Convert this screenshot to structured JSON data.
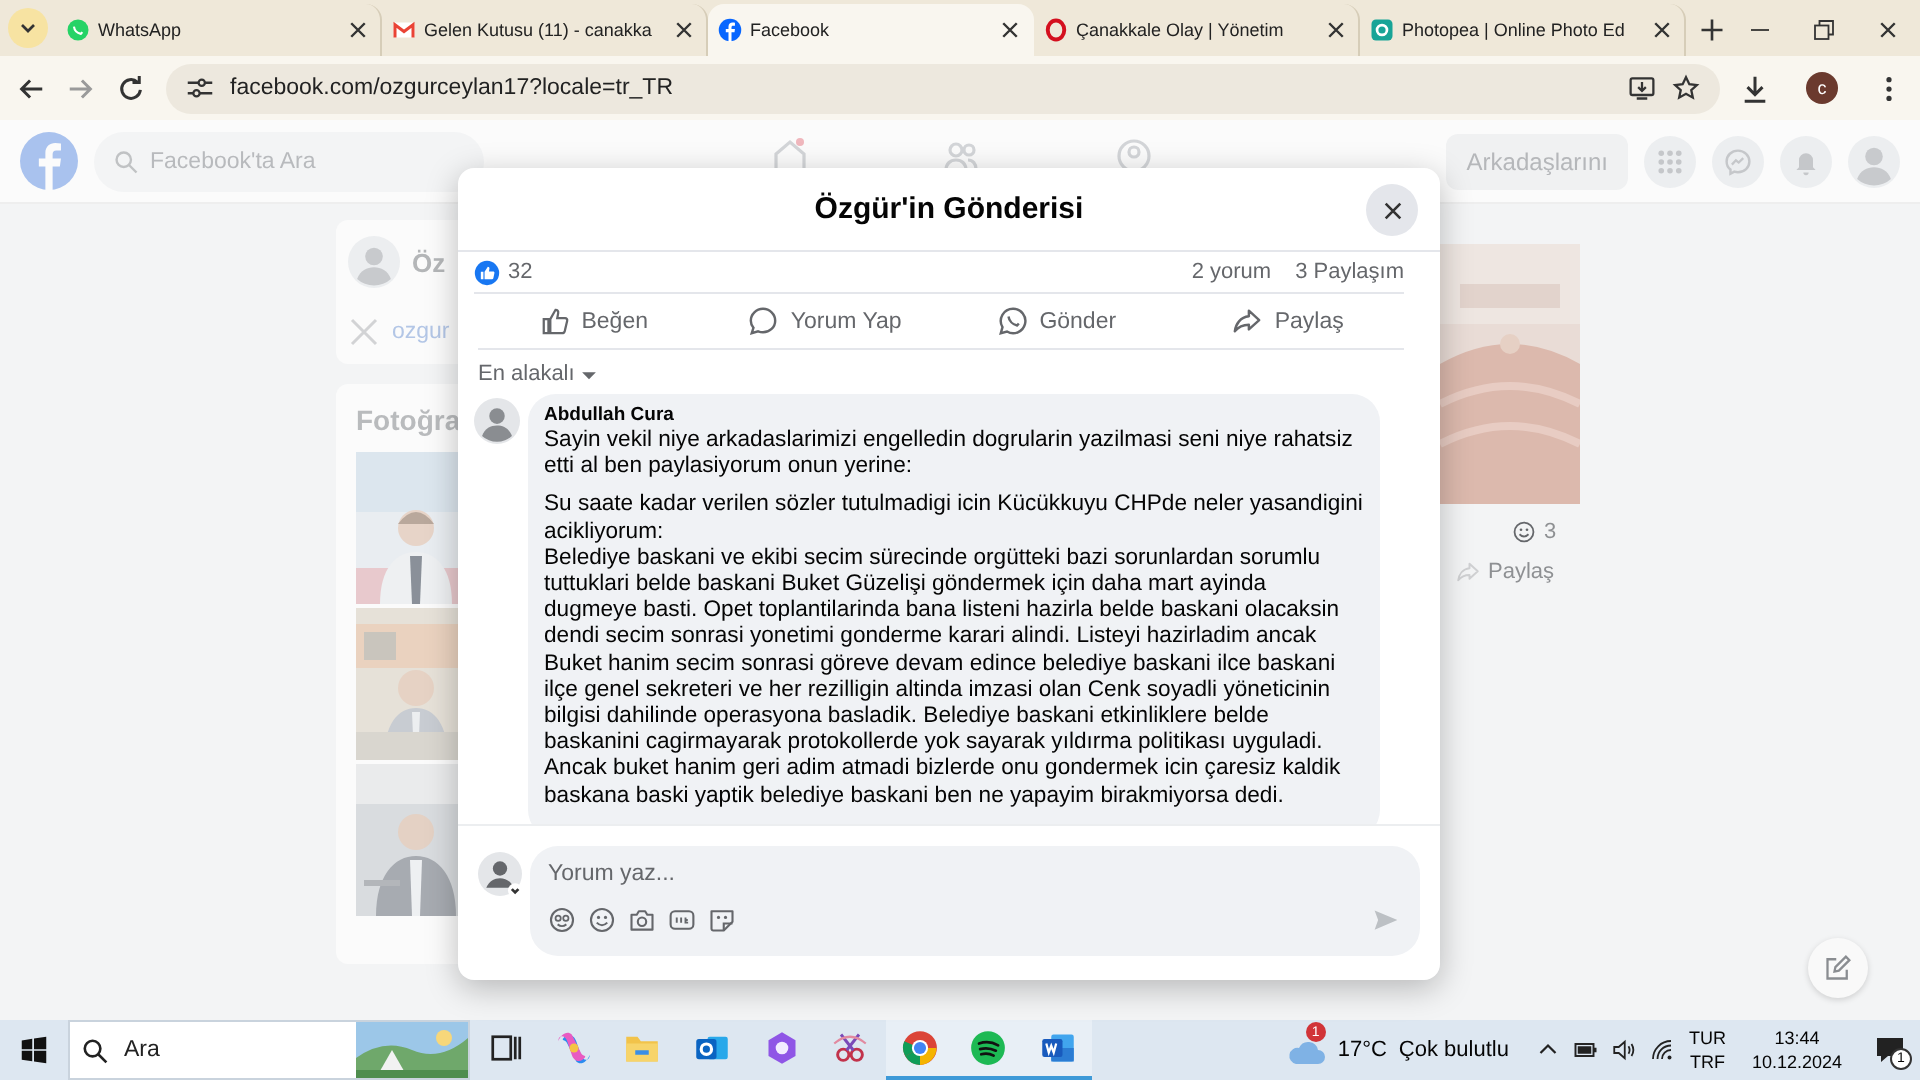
{
  "browser": {
    "tabs": [
      {
        "title": "WhatsApp",
        "kind": "whatsapp",
        "selected": false
      },
      {
        "title": "Gelen Kutusu (11) - canakka",
        "kind": "gmail",
        "selected": false
      },
      {
        "title": "Facebook",
        "kind": "facebook",
        "selected": true
      },
      {
        "title": "Çanakkale Olay | Yönetim",
        "kind": "opera",
        "selected": false
      },
      {
        "title": "Photopea | Online Photo Ed",
        "kind": "photopea",
        "selected": false
      }
    ],
    "address": "facebook.com/ozgurceylan17?locale=tr_TR",
    "profile_initial": "c"
  },
  "background_page": {
    "search_placeholder": "Facebook'ta Ara",
    "friends_button": "Arkadaşlarını",
    "profile_name": "Öz",
    "profile_link": "ozgur",
    "photos_heading": "Fotoğra",
    "reaction_count": "3",
    "share_button": "Paylaş"
  },
  "post_dialog": {
    "title": "Özgür'in Gönderisi",
    "likes": "32",
    "comments_count": "2 yorum",
    "shares_count": "3 Paylaşım",
    "actions": [
      {
        "label": "Beğen",
        "kind": "like"
      },
      {
        "label": "Yorum Yap",
        "kind": "comment"
      },
      {
        "label": "Gönder",
        "kind": "whatsapp"
      },
      {
        "label": "Paylaş",
        "kind": "share"
      }
    ],
    "sort": "En alakalı",
    "comments": [
      {
        "author": "Abdullah Cura",
        "paragraphs": [
          "Sayin vekil niye arkadaslarimizi engelledin dogrularin yazilmasi seni niye rahatsiz etti al ben paylasiyorum onun yerine:",
          "Su saate kadar verilen sözler tutulmadigi icin Kücükkuyu CHPde neler yasandigini acikliyorum:\nBelediye baskani ve ekibi secim sürecinde orgütteki bazi sorunlardan sorumlu tuttuklari belde baskani Buket Güzelişi göndermek için daha mart ayinda dugmeye basti. Opet toplantilarinda bana listeni hazirla belde baskani olacaksin dendi secim sonrasi yonetimi gonderme karari alindi. Listeyi hazirladim ancak Buket hanim secim sonrasi göreve devam edince belediye baskani ilce baskani ilçe genel sekreteri ve her rezilligin altinda imzasi olan Cenk soyadli yöneticinin bilgisi dahilinde operasyona basladik. Belediye baskani etkinliklere belde baskanini cagirmayarak protokollerde yok sayarak yıldırma politikası uyguladi. Ancak buket hanim geri adim atmadi bizlerde onu gondermek icin çaresiz kaldik baskana baski yaptik belediye baskani ben ne yapayim birakmiyorsa dedi."
        ]
      }
    ],
    "composer": {
      "placeholder": "Yorum yaz..."
    }
  },
  "taskbar": {
    "search_placeholder": "Ara",
    "apps": [
      {
        "kind": "taskview",
        "running": false
      },
      {
        "kind": "copilot",
        "running": false
      },
      {
        "kind": "folder",
        "running": false
      },
      {
        "kind": "outlook",
        "running": false
      },
      {
        "kind": "purple",
        "running": false
      },
      {
        "kind": "snip",
        "running": false
      },
      {
        "kind": "chrome",
        "running": true
      },
      {
        "kind": "spotify",
        "running": true
      },
      {
        "kind": "word",
        "running": true
      }
    ],
    "weather": {
      "badge": "1",
      "temperature": "17°C",
      "condition": "Çok bulutlu"
    },
    "language": "TUR",
    "layout": "TRF",
    "time": "13:44",
    "date": "10.12.2024",
    "notifications": "1"
  }
}
